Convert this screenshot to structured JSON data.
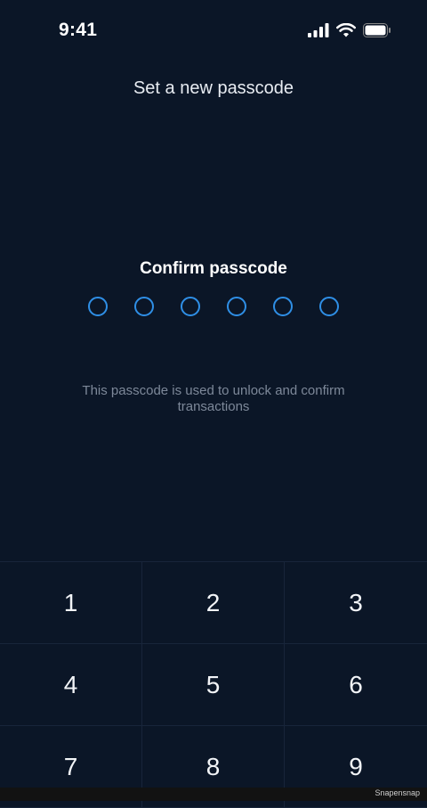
{
  "status_bar": {
    "time": "9:41",
    "icons": [
      "signal-icon",
      "wifi-icon",
      "battery-icon"
    ]
  },
  "screen": {
    "title": "Set a new passcode",
    "confirm_label": "Confirm passcode",
    "passcode_length": 6,
    "hint": "This passcode is used to unlock and confirm transactions"
  },
  "keypad": {
    "keys": [
      "1",
      "2",
      "3",
      "4",
      "5",
      "6",
      "7",
      "8",
      "9"
    ]
  },
  "footer": {
    "watermark": "Snapensnap"
  },
  "colors": {
    "background": "#0b1627",
    "dot_accent": "#2f8fe6",
    "hint_text": "#7d8899"
  }
}
